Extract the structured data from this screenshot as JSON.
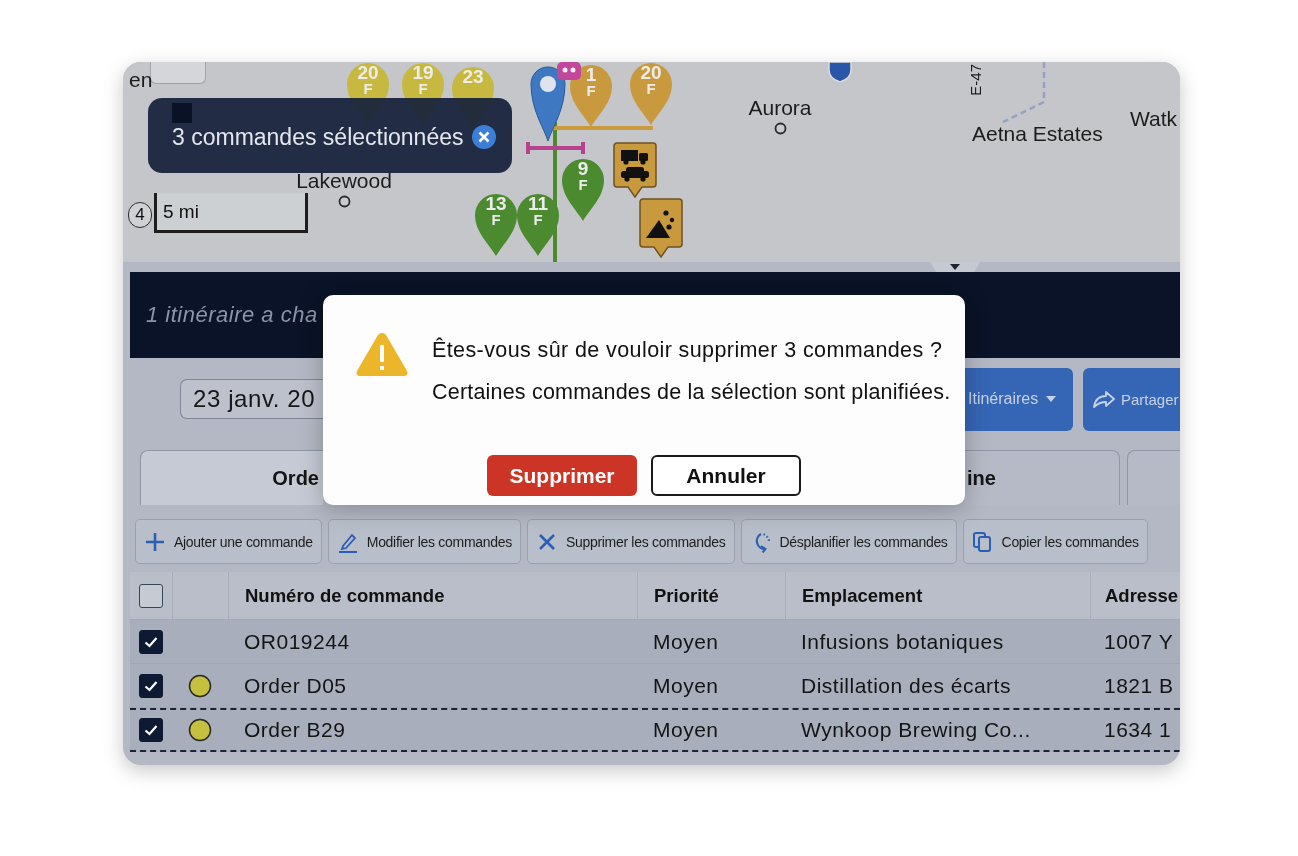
{
  "map": {
    "place_labels": [
      {
        "text": "en",
        "kind": "area"
      },
      {
        "text": "Lakewood",
        "kind": "town"
      },
      {
        "text": "Aurora",
        "kind": "town"
      },
      {
        "text": "Aetna Estates",
        "kind": "area"
      },
      {
        "text": "Watk",
        "kind": "area"
      },
      {
        "text": "E-47",
        "kind": "road"
      }
    ],
    "pins": [
      {
        "label": "20",
        "sub": "F",
        "color": "#c7b93f"
      },
      {
        "label": "19",
        "sub": "F",
        "color": "#c7b93f"
      },
      {
        "label": "23",
        "color": "#c7b93f"
      },
      {
        "label": "1",
        "sub": "F",
        "color": "#c9993e"
      },
      {
        "label": "20",
        "sub": "F",
        "color": "#c9993e"
      },
      {
        "label": "9",
        "sub": "F",
        "color": "#4c8a30"
      },
      {
        "label": "13",
        "sub": "F",
        "color": "#4c8a30"
      },
      {
        "label": "11",
        "sub": "F",
        "color": "#4c8a30"
      }
    ],
    "selection_toast": {
      "text": "3 commandes sélectionnées"
    },
    "scale": {
      "badge": "4",
      "distance": "5 mi"
    }
  },
  "banner": {
    "text": "1 itinéraire a cha"
  },
  "toolbar": {
    "date": "23 janv. 20",
    "buttons": [
      {
        "label": "Itinéraires",
        "kind": "dropdown"
      },
      {
        "label": "Partager",
        "kind": "share"
      }
    ]
  },
  "tabs": [
    {
      "label": "Orde",
      "selected": true
    },
    {
      "label": "ine",
      "selected": false
    },
    {
      "selected": false
    }
  ],
  "actions": [
    {
      "label": "Ajouter une commande",
      "kind": "add"
    },
    {
      "label": "Modifier les commandes",
      "kind": "edit"
    },
    {
      "label": "Supprimer les commandes",
      "kind": "delete"
    },
    {
      "label": "Désplanifier les commandes",
      "kind": "unschedule"
    },
    {
      "label": "Copier les commandes",
      "kind": "copy"
    }
  ],
  "table": {
    "header_checkbox": {
      "checked": false
    },
    "columns": [
      "Numéro de commande",
      "Priorité",
      "Emplacement",
      "Adresse"
    ],
    "rows": [
      {
        "checked": true,
        "highlighted": false,
        "order": "OR019244",
        "priority": "Moyen",
        "location": "Infusions botaniques",
        "address": "1007 Y"
      },
      {
        "checked": true,
        "highlighted": false,
        "color": "#c5c03f",
        "order": "Order D05",
        "priority": "Moyen",
        "location": "Distillation des écarts",
        "address": "1821 B"
      },
      {
        "checked": true,
        "highlighted": true,
        "color": "#c5c03f",
        "order": "Order B29",
        "priority": "Moyen",
        "location": "Wynkoop Brewing Co...",
        "address": "1634 1"
      }
    ]
  },
  "dialog": {
    "title": "Êtes-vous sûr de vouloir supprimer 3 commandes ?",
    "message": "Certaines commandes de la sélection sont planifiées.",
    "buttons": [
      {
        "label": "Supprimer",
        "kind": "danger"
      },
      {
        "label": "Annuler",
        "kind": "cancel"
      }
    ]
  }
}
